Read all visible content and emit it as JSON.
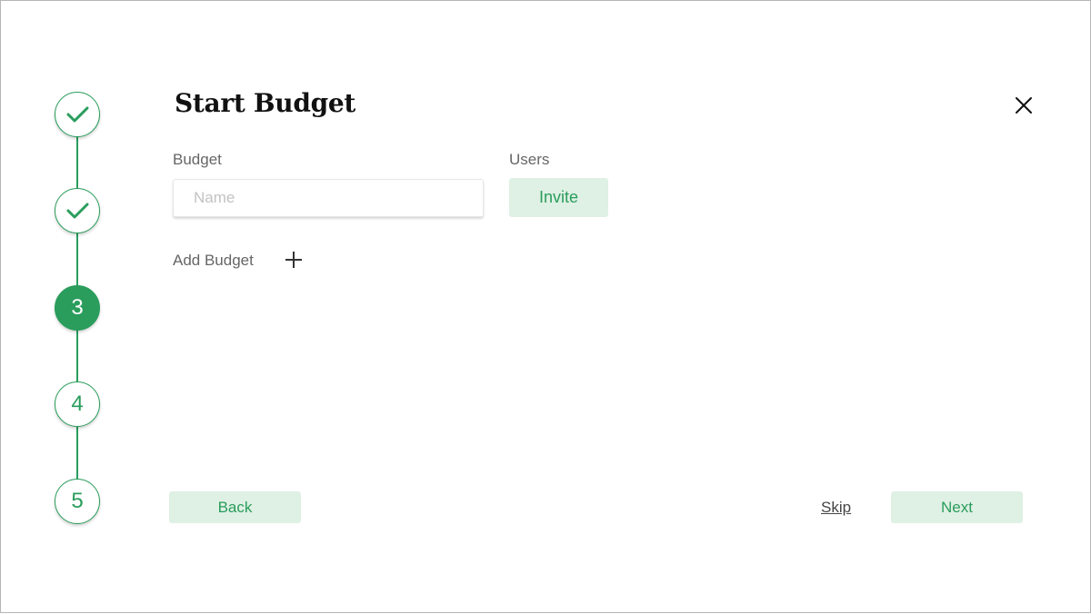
{
  "colors": {
    "accent": "#2a9d5c",
    "button_bg": "#dff0e4",
    "label": "#666666",
    "placeholder": "#c2c2c2"
  },
  "stepper": {
    "steps": [
      {
        "label": "",
        "state": "completed",
        "icon": "checkmark-icon"
      },
      {
        "label": "",
        "state": "completed",
        "icon": "checkmark-icon"
      },
      {
        "label": "3",
        "state": "active"
      },
      {
        "label": "4",
        "state": "upcoming"
      },
      {
        "label": "5",
        "state": "upcoming"
      }
    ]
  },
  "header": {
    "title": "Start Budget",
    "close_icon": "close-icon"
  },
  "form": {
    "budget_label": "Budget",
    "name_placeholder": "Name",
    "name_value": "",
    "users_label": "Users",
    "invite_label": "Invite",
    "add_budget_label": "Add Budget",
    "add_icon": "plus-icon"
  },
  "footer": {
    "back_label": "Back",
    "skip_label": "Skip",
    "next_label": "Next"
  }
}
